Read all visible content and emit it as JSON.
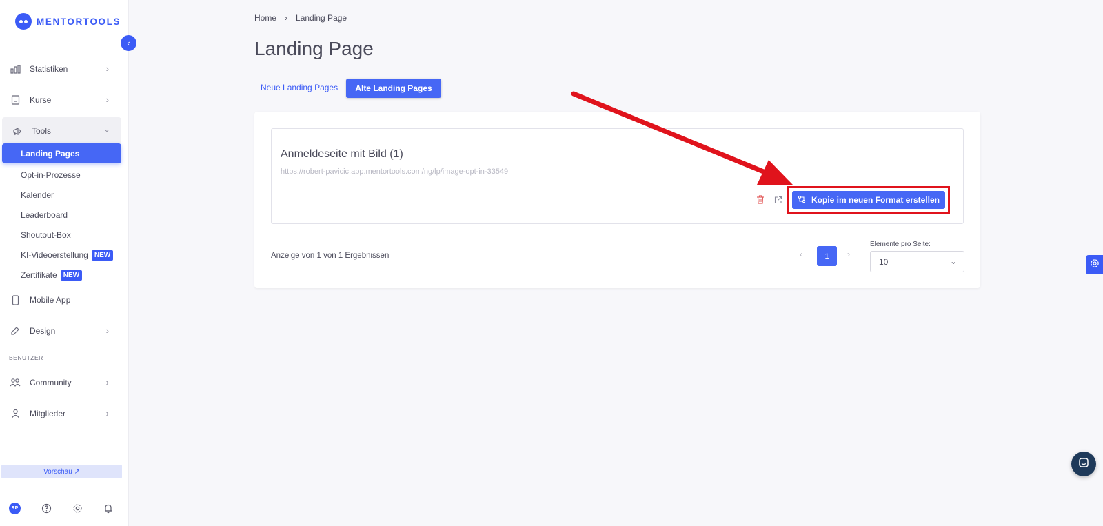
{
  "app": {
    "logo_text": "MENTORTOOLS"
  },
  "sidebar": {
    "items": [
      {
        "label": "Statistiken"
      },
      {
        "label": "Kurse"
      },
      {
        "label": "Tools"
      },
      {
        "label": "Mobile App"
      },
      {
        "label": "Design"
      },
      {
        "label": "Community"
      },
      {
        "label": "Mitglieder"
      }
    ],
    "tools_sub": [
      {
        "label": "Landing Pages"
      },
      {
        "label": "Opt-in-Prozesse"
      },
      {
        "label": "Kalender"
      },
      {
        "label": "Leaderboard"
      },
      {
        "label": "Shoutout-Box"
      },
      {
        "label": "KI-Videoerstellung",
        "badge": "NEW"
      },
      {
        "label": "Zertifikate",
        "badge": "NEW"
      }
    ],
    "section_benutzer": "BENUTZER",
    "preview_label": "Vorschau ↗",
    "avatar_initials": "RP"
  },
  "breadcrumb": {
    "home": "Home",
    "separator": "›",
    "current": "Landing Page"
  },
  "page": {
    "title": "Landing Page",
    "tabs": {
      "new": "Neue Landing Pages",
      "old": "Alte Landing Pages"
    }
  },
  "item": {
    "title": "Anmeldeseite mit Bild (1)",
    "url": "https://robert-pavicic.app.mentortools.com/ng/lp/image-opt-in-33549",
    "copy_button": "Kopie im neuen Format erstellen"
  },
  "pagination": {
    "results_text": "Anzeige von 1 von 1 Ergebnissen",
    "current_page": "1",
    "per_page_label": "Elemente pro Seite:",
    "per_page_value": "10"
  },
  "colors": {
    "accent": "#4667f5",
    "annotation": "#e0131c"
  }
}
